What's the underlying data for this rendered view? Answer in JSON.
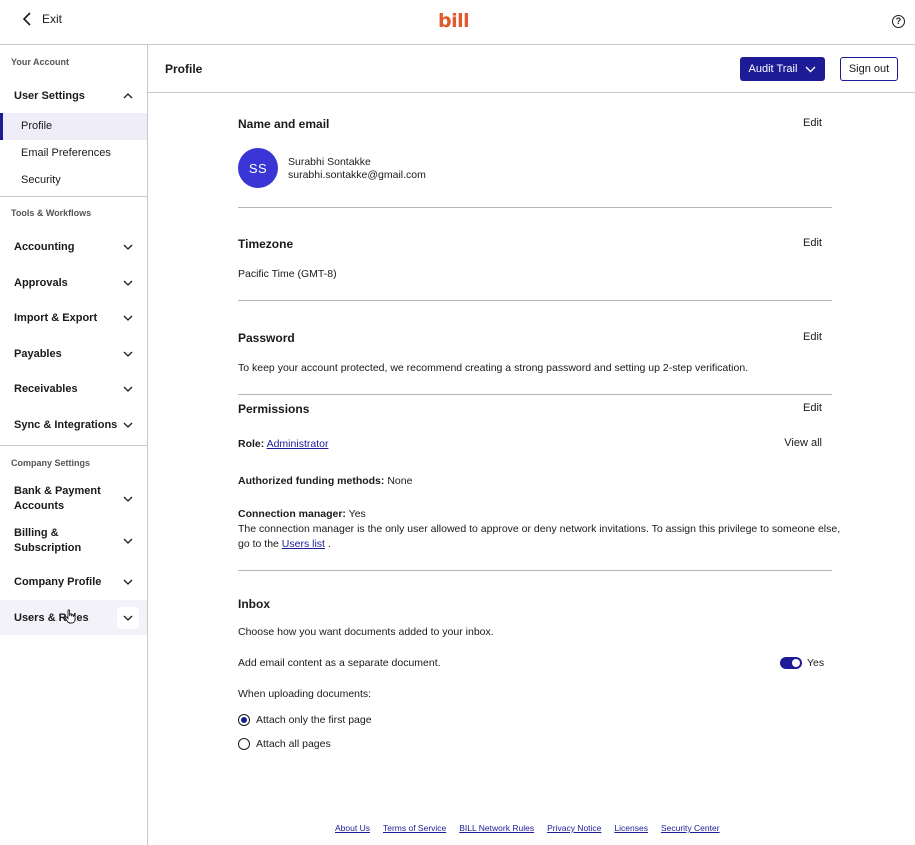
{
  "topbar": {
    "exit_label": "Exit",
    "logo_text": "bill",
    "help_glyph": "?"
  },
  "sidebar": {
    "section_account": "Your Account",
    "user_settings": "User Settings",
    "user_settings_items": [
      "Profile",
      "Email Preferences",
      "Security"
    ],
    "section_tools": "Tools & Workflows",
    "tools_items": [
      "Accounting",
      "Approvals",
      "Import & Export",
      "Payables",
      "Receivables",
      "Sync & Integrations"
    ],
    "section_company": "Company Settings",
    "company_items": [
      "Bank & Payment Accounts",
      "Billing & Subscription",
      "Company Profile",
      "Users & Roles"
    ]
  },
  "header": {
    "title": "Profile",
    "audit_trail": "Audit Trail",
    "sign_out": "Sign out"
  },
  "name_email": {
    "title": "Name and email",
    "edit": "Edit",
    "initials": "SS",
    "name": "Surabhi Sontakke",
    "email": "surabhi.sontakke@gmail.com"
  },
  "timezone": {
    "title": "Timezone",
    "edit": "Edit",
    "value": "Pacific Time (GMT-8)"
  },
  "password": {
    "title": "Password",
    "edit": "Edit",
    "note": "To keep your account protected, we recommend creating a strong password and setting up 2-step verification."
  },
  "permissions": {
    "title": "Permissions",
    "edit": "Edit",
    "role_label": "Role:",
    "role_value": "Administrator",
    "view_all": "View all",
    "funding_label": "Authorized funding methods:",
    "funding_value": "None",
    "conn_label": "Connection manager:",
    "conn_value": "Yes",
    "conn_note": "The connection manager is the only user allowed to approve or deny network invitations. To assign this privilege to someone else,",
    "conn_note2_prefix": "go to the",
    "users_list": "Users list",
    "conn_note2_suffix": "."
  },
  "inbox": {
    "title": "Inbox",
    "subtitle": "Choose how you want documents added to your inbox.",
    "email_content_label": "Add email content as a separate document.",
    "toggle_value": "Yes",
    "uploading_label": "When uploading documents:",
    "option_first": "Attach only the first page",
    "option_all": "Attach all pages"
  },
  "footer": {
    "links": [
      "About Us",
      "Terms of Service",
      "BILL Network Rules",
      "Privacy Notice",
      "Licenses",
      "Security Center"
    ]
  },
  "colors": {
    "brand": "#e0582c",
    "accent": "#1d1c96",
    "avatar": "#3a36d6"
  }
}
